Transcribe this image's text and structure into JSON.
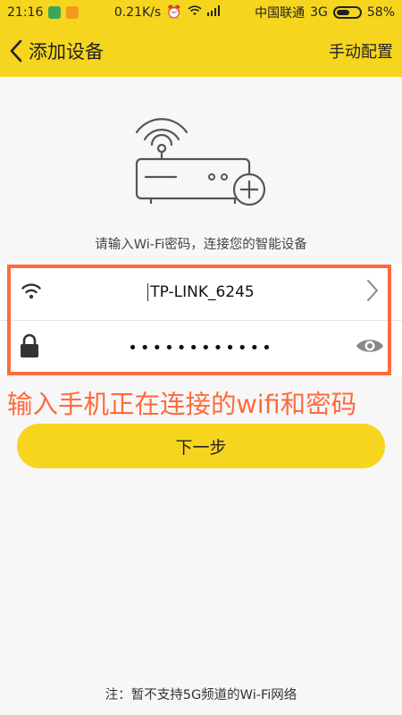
{
  "status_bar": {
    "time": "21:16",
    "network_speed": "0.21K/s",
    "carrier": "中国联通",
    "network_type": "3G",
    "battery": "58%"
  },
  "header": {
    "back_icon": "chevron-left-icon",
    "title": "添加设备",
    "manual_config": "手动配置",
    "background_color": "#f6d51f"
  },
  "illustration": {
    "icon": "router-add-icon"
  },
  "instruction": "请输入Wi-Fi密码，连接您的智能设备",
  "form": {
    "ssid": {
      "icon": "wifi-icon",
      "value": "TP-LINK_6245",
      "action_icon": "chevron-right-icon"
    },
    "password": {
      "icon": "lock-icon",
      "masked_value": "••••••••••••",
      "toggle_icon": "eye-icon"
    }
  },
  "annotation": {
    "text": "输入手机正在连接的wifi和密码",
    "color": "#ff6a3c"
  },
  "next_button": "下一步",
  "footnote": "注：暂不支持5G频道的Wi-Fi网络"
}
